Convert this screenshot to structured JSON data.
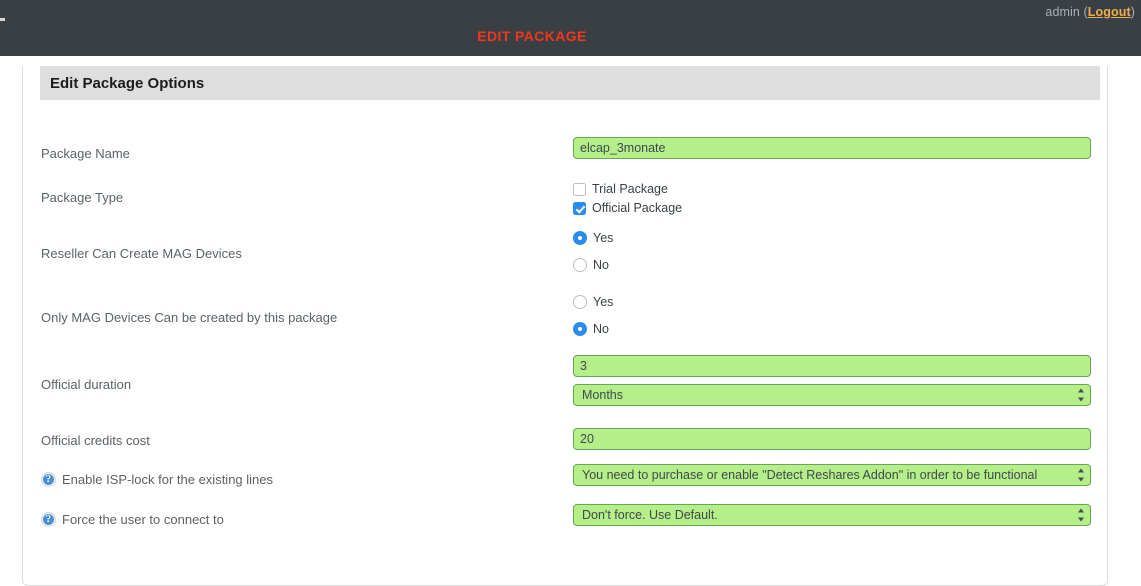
{
  "topbar": {
    "user_prefix": "admin (",
    "logout_label": "Logout",
    "user_suffix": ")",
    "title": "EDIT PACKAGE",
    "title_color": "#f4361b",
    "background_color": "#3a3f44"
  },
  "panel": {
    "heading": "Edit Package Options"
  },
  "theme": {
    "input_fill": "#b4ef8a",
    "input_border": "#6aa84f",
    "accent_blue": "#2a8cf0",
    "panel_header_gray": "#dedede"
  },
  "form": {
    "package_name": {
      "label": "Package Name",
      "value": "elcap_3monate"
    },
    "package_type": {
      "label": "Package Type",
      "options": [
        {
          "label": "Trial Package",
          "checked": false
        },
        {
          "label": "Official Package",
          "checked": true
        }
      ]
    },
    "reseller_mag": {
      "label": "Reseller Can Create MAG Devices",
      "options": [
        {
          "label": "Yes",
          "selected": true
        },
        {
          "label": "No",
          "selected": false
        }
      ]
    },
    "only_mag": {
      "label": "Only MAG Devices Can be created by this package",
      "options": [
        {
          "label": "Yes",
          "selected": false
        },
        {
          "label": "No",
          "selected": true
        }
      ]
    },
    "official_duration": {
      "label": "Official duration",
      "value": "3",
      "unit_selected": "Months"
    },
    "official_credits": {
      "label": "Official credits cost",
      "value": "20"
    },
    "isp_lock": {
      "label": "Enable ISP-lock for the existing lines",
      "icon": "help-circle-icon",
      "selected": "You need to purchase or enable \"Detect Reshares Addon\" in order to be functional"
    },
    "force_connect": {
      "label": "Force the user to connect to",
      "icon": "help-circle-icon",
      "selected": "Don't force. Use Default."
    }
  }
}
